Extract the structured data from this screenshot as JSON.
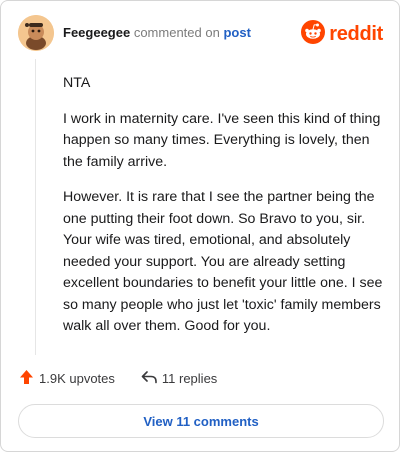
{
  "comment": {
    "author": "Feegeegee",
    "verb": "commented on",
    "link": "post",
    "paragraphs": [
      "NTA",
      "I work in maternity care. I've seen this kind of thing happen so many times. Everything is lovely, then the family arrive.",
      "However. It is rare that I see the partner being the one putting their foot down. So Bravo to you, sir. Your wife was tired, emotional, and absolutely needed your support. You are already setting excellent boundaries to benefit your little one. I see so many people who just let 'toxic' family members walk all over them. Good for you."
    ]
  },
  "brand": {
    "wordmark": "reddit",
    "color": "#ff4500"
  },
  "actions": {
    "upvotes": "1.9K upvotes",
    "replies": "11 replies"
  },
  "view_button": "View 11 comments",
  "icons": [
    "avatar",
    "reddit-logo-icon",
    "upvote-arrow-icon",
    "reply-arrow-icon"
  ]
}
